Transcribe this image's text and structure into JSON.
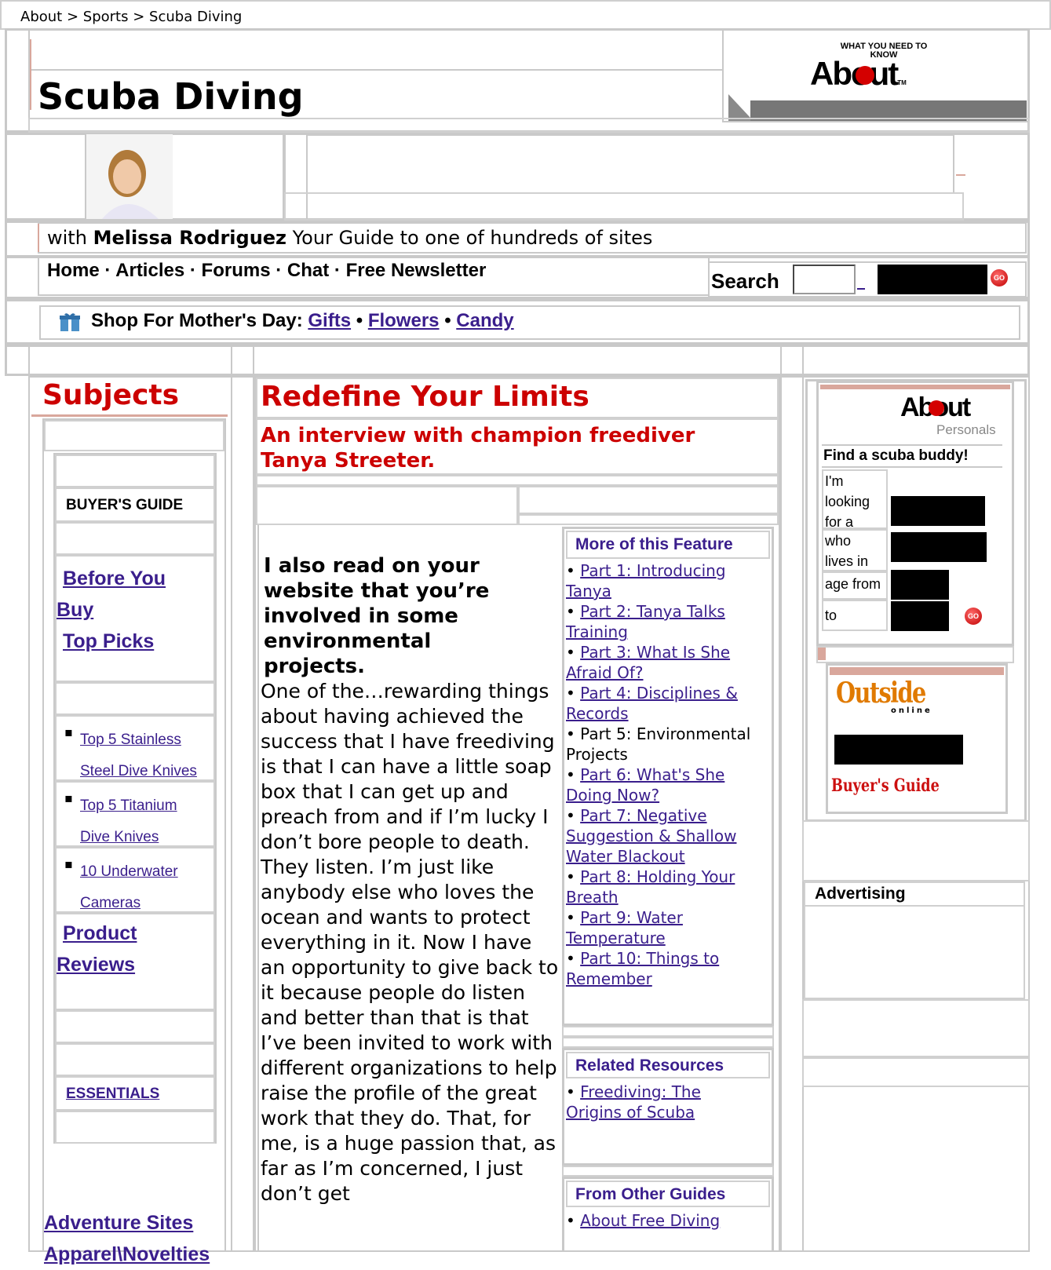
{
  "breadcrumb": [
    "About",
    "Sports",
    "Scuba Diving"
  ],
  "breadcrumb_sep": ">",
  "site": {
    "title": "Scuba Diving",
    "logo_tagline": "WHAT YOU NEED TO KNOW",
    "logo_text": "About",
    "logo_tm": "TM"
  },
  "guide": {
    "prefix": "with",
    "name": "Melissa Rodriguez",
    "suffix": "Your Guide to one of hundreds of sites"
  },
  "nav": {
    "items": [
      "Home",
      "Articles",
      "Forums",
      "Chat",
      "Free Newsletter"
    ],
    "sep": "·",
    "search_label": "Search",
    "go_label": "GO"
  },
  "shop": {
    "label": "Shop For Mother's Day:",
    "links": [
      "Gifts",
      "Flowers",
      "Candy"
    ],
    "bullet": "•"
  },
  "left": {
    "heading": "Subjects",
    "buyers_guide": "BUYER'S GUIDE",
    "before_you_buy": "Before You Buy",
    "top_picks": "Top Picks",
    "picks": [
      "Top 5 Stainless Steel Dive Knives",
      "Top 5 Titanium Dive Knives",
      "10 Underwater Cameras"
    ],
    "product_reviews": "Product Reviews",
    "essentials": "ESSENTIALS",
    "adventure_sites": "Adventure Sites",
    "apparel": "Apparel\\Novelties"
  },
  "article": {
    "title": "Redefine Your Limits",
    "subtitle": "An interview with champion freediver Tanya Streeter.",
    "question": "I also read on your website that you’re involved in some environmental projects.",
    "body": "One of the…rewarding things about having achieved the success that I have freediving is that I can have a little soap box that I can get up and preach from and if I’m lucky I don’t bore people to death. They listen. I’m just like anybody else who loves the ocean and wants to protect everything in it. Now I have an opportunity to give back to it because people do listen and better than that is that I’ve been invited to work with different organizations to help raise the profile of the great work that they do. That, for me, is a huge passion that, as far as I’m concerned, I just don’t get"
  },
  "feature": {
    "heading": "More of this Feature",
    "parts": [
      {
        "text": "Part 1: Introducing Tanya",
        "link": true
      },
      {
        "text": "Part 2: Tanya Talks Training",
        "link": true
      },
      {
        "text": "Part 3: What Is She Afraid Of?",
        "link": true
      },
      {
        "text": "Part 4: Disciplines & Records",
        "link": true
      },
      {
        "text": "Part 5: Environmental Projects",
        "link": false
      },
      {
        "text": "Part 6: What's She Doing Now?",
        "link": true
      },
      {
        "text": "Part 7: Negative Suggestion & Shallow Water Blackout",
        "link": true
      },
      {
        "text": "Part 8: Holding Your Breath",
        "link": true
      },
      {
        "text": "Part 9: Water Temperature",
        "link": true
      },
      {
        "text": "Part 10: Things to Remember",
        "link": true
      }
    ],
    "related_heading": "Related Resources",
    "related": [
      "Freediving: The Origins of Scuba"
    ],
    "other_heading": "From Other Guides",
    "other": [
      "About Free Diving"
    ]
  },
  "right": {
    "personals_logo": "About",
    "personals_sub": "Personals",
    "find_buddy": "Find a scuba buddy!",
    "looking_for": "I'm looking for a",
    "lives_in": "who lives in",
    "age_from": "age from",
    "to": "to",
    "outside_logo": "Outside",
    "outside_sub": "online",
    "outside_buyers": "Buyer's Guide",
    "advertising": "Advertising"
  },
  "colors": {
    "link": "#3a1e8c",
    "accent_red": "#cc0000",
    "border": "#c9c9c9"
  }
}
